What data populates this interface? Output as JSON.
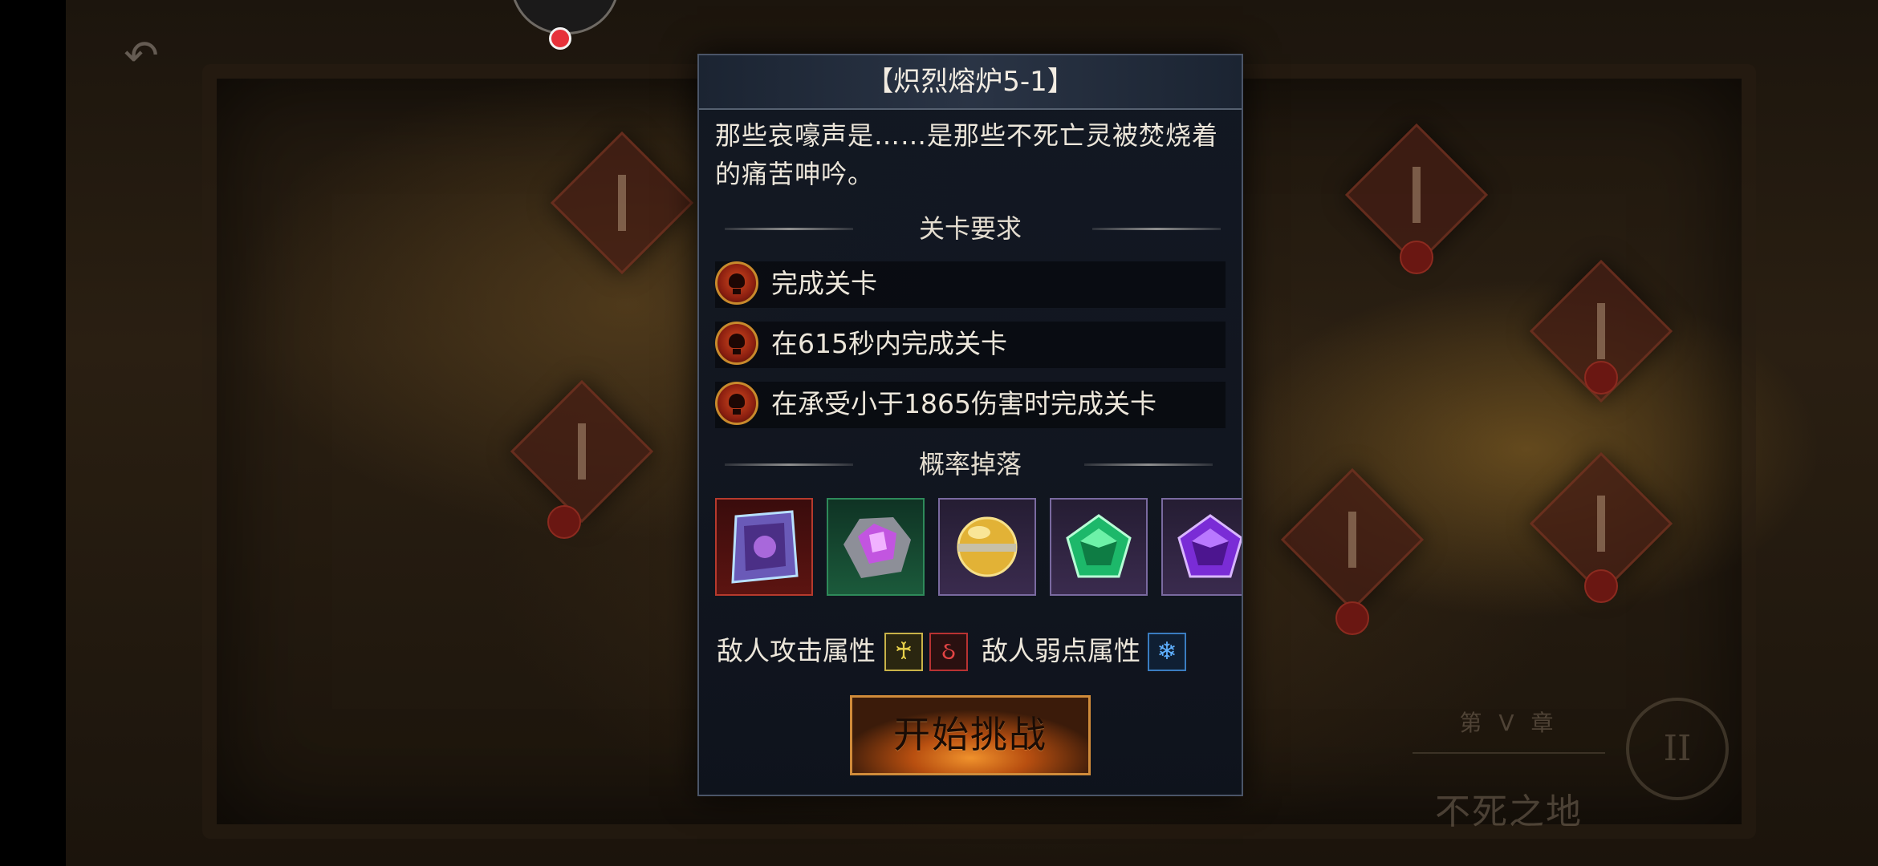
{
  "dialog": {
    "title": "【炽烈熔炉5-1】",
    "description": "那些哀嚎声是……是那些不死亡灵被焚烧着的痛苦呻吟。",
    "requirements_title": "关卡要求",
    "requirements": [
      {
        "icon": "skull-icon",
        "text": "完成关卡"
      },
      {
        "icon": "skull-icon",
        "text": "在615秒内完成关卡"
      },
      {
        "icon": "skull-icon",
        "text": "在承受小于1865伤害时完成关卡"
      }
    ],
    "drops_title": "概率掉落",
    "drops": [
      {
        "icon": "rainbow-crystal-icon",
        "rarity_color": "#b0231c"
      },
      {
        "icon": "purple-ore-icon",
        "rarity_color": "#1f6b45"
      },
      {
        "icon": "golden-orb-icon",
        "rarity_color": "#4a3a66"
      },
      {
        "icon": "green-gem-icon",
        "rarity_color": "#4a3a66"
      },
      {
        "icon": "purple-gem-icon",
        "rarity_color": "#4a3a66"
      }
    ],
    "enemy_attack_label": "敌人攻击属性",
    "enemy_attack_icons": [
      "sword-icon",
      "fire-icon"
    ],
    "enemy_weakness_label": "敌人弱点属性",
    "enemy_weakness_icons": [
      "ice-icon"
    ],
    "start_button": "开始挑战"
  },
  "background": {
    "chapter_label": "第 V 章",
    "chapter_name": "不死之地",
    "emblem": "II"
  }
}
